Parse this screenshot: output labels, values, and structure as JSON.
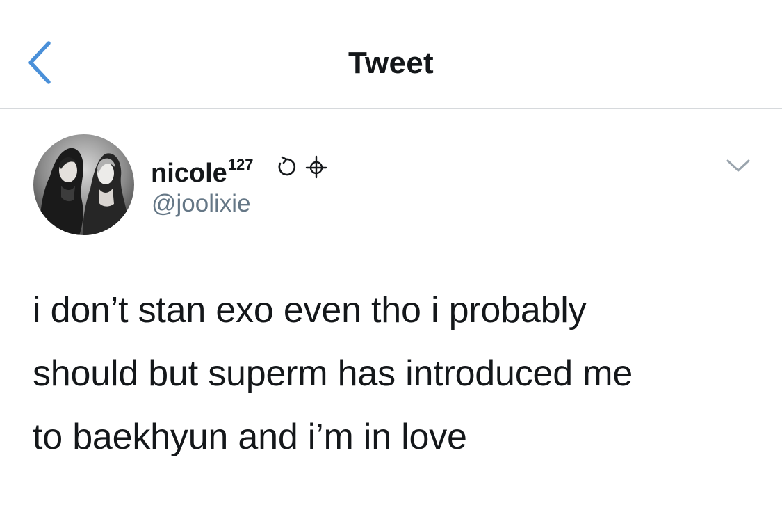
{
  "header": {
    "title": "Tweet",
    "back_icon": "chevron-left-icon"
  },
  "tweet": {
    "author": {
      "display_name": "nicole",
      "superscript": "127",
      "emojis": [
        "refresh-icon",
        "crosshair-icon"
      ],
      "username": "@joolixie"
    },
    "menu_icon": "chevron-down-icon",
    "text_lines": [
      "i don’t stan exo even tho i probably",
      "should but superm has introduced me",
      "to baekhyun and i’m in love"
    ]
  },
  "colors": {
    "accent": "#4a90d9",
    "text": "#14171a",
    "secondary": "#657786",
    "divider": "#d6d9dc"
  }
}
